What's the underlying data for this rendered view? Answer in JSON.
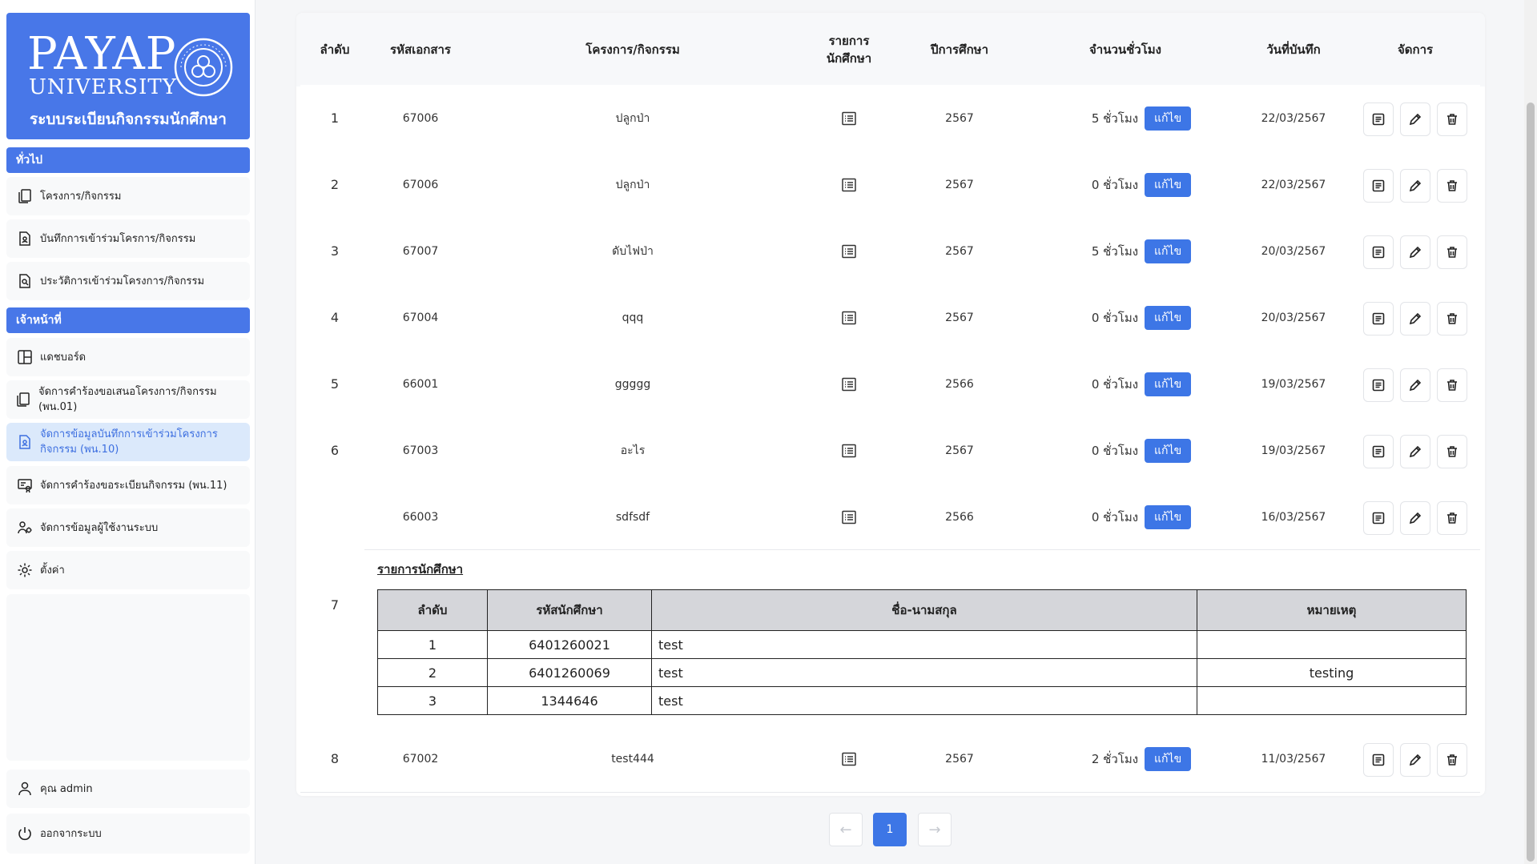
{
  "sidebar": {
    "logo_word": "PAYAP",
    "logo_sub": "UNIVERSITY",
    "logo_seal_text": "PAYAP UNIVERSITY · TRUTH · SERVICE",
    "system_title": "ระบบระเบียนกิจกรรมนักศึกษา",
    "section_general": "ทั่วไป",
    "section_staff": "เจ้าหน้าที่",
    "general_items": [
      {
        "label": "โครงการ/กิจกรรม",
        "icon": "documents-icon"
      },
      {
        "label": "บันทึกการเข้าร่วมโครการ/กิจกรรม",
        "icon": "user-file-icon"
      },
      {
        "label": "ประวัติการเข้าร่วมโครงการ/กิจกรรม",
        "icon": "file-search-icon"
      }
    ],
    "staff_items": [
      {
        "label": "แดชบอร์ด",
        "icon": "dashboard-icon"
      },
      {
        "label": "จัดการคำร้องขอเสนอโครงการ/กิจกรรม (พน.01)",
        "icon": "documents-icon"
      },
      {
        "label": "จัดการข้อมูลบันทึกการเข้าร่วมโครงการกิจกรรม (พน.10)",
        "icon": "user-file-icon"
      },
      {
        "label": "จัดการคำร้องขอระเบียนกิจกรรม (พน.11)",
        "icon": "certificate-icon"
      },
      {
        "label": "จัดการข้อมูลผู้ใช้งานระบบ",
        "icon": "users-gear-icon"
      },
      {
        "label": "ตั้งค่า",
        "icon": "gear-icon"
      }
    ],
    "user_label": "คุณ admin",
    "logout_label": "ออกจากระบบ"
  },
  "table": {
    "headers": {
      "no": "ลำดับ",
      "doc_id": "รหัสเอกสาร",
      "project": "โครงการ/กิจกรรม",
      "students": "รายการนักศึกษา",
      "year": "ปีการศึกษา",
      "hours": "จำนวนชั่วโมง",
      "date": "วันที่บันทึก",
      "manage": "จัดการ"
    },
    "edit_label": "แก้ไข",
    "rows": [
      {
        "no": "1",
        "doc_id": "67006",
        "project": "ปลูกป่า",
        "year": "2567",
        "hours": "5 ชั่วโมง",
        "date": "22/03/2567"
      },
      {
        "no": "2",
        "doc_id": "67006",
        "project": "ปลูกป่า",
        "year": "2567",
        "hours": "0 ชั่วโมง",
        "date": "22/03/2567"
      },
      {
        "no": "3",
        "doc_id": "67007",
        "project": "ดับไฟป่า",
        "year": "2567",
        "hours": "5 ชั่วโมง",
        "date": "20/03/2567"
      },
      {
        "no": "4",
        "doc_id": "67004",
        "project": "qqq",
        "year": "2567",
        "hours": "0 ชั่วโมง",
        "date": "20/03/2567"
      },
      {
        "no": "5",
        "doc_id": "66001",
        "project": "ggggg",
        "year": "2566",
        "hours": "0 ชั่วโมง",
        "date": "19/03/2567"
      },
      {
        "no": "6",
        "doc_id": "67003",
        "project": "อะไร",
        "year": "2567",
        "hours": "0 ชั่วโมง",
        "date": "19/03/2567"
      },
      {
        "no": "7",
        "doc_id": "66003",
        "project": "sdfsdf",
        "year": "2566",
        "hours": "0 ชั่วโมง",
        "date": "16/03/2567"
      },
      {
        "no": "8",
        "doc_id": "67002",
        "project": "test444",
        "year": "2567",
        "hours": "2 ชั่วโมง",
        "date": "11/03/2567"
      }
    ],
    "expanded": {
      "title": "รายการนักศึกษา",
      "headers": {
        "no": "ลำดับ",
        "student_id": "รหัสนักศึกษา",
        "name": "ชื่อ-นามสกุล",
        "note": "หมายเหตุ"
      },
      "rows": [
        {
          "no": "1",
          "student_id": "6401260021",
          "name": "test",
          "note": ""
        },
        {
          "no": "2",
          "student_id": "6401260069",
          "name": "test",
          "note": "testing"
        },
        {
          "no": "3",
          "student_id": "1344646",
          "name": "test",
          "note": ""
        }
      ]
    }
  },
  "pagination": {
    "prev": "←",
    "current": "1",
    "next": "→"
  }
}
